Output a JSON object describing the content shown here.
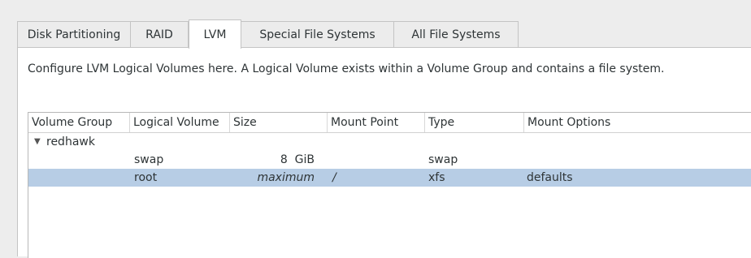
{
  "tabs": [
    {
      "label": "Disk Partitioning",
      "active": false
    },
    {
      "label": "RAID",
      "active": false
    },
    {
      "label": "LVM",
      "active": true
    },
    {
      "label": "Special File Systems",
      "active": false
    },
    {
      "label": "All File Systems",
      "active": false
    }
  ],
  "description": "Configure LVM Logical Volumes here.  A Logical Volume exists within a Volume Group and contains a file system.",
  "columns": {
    "volume_group": "Volume Group",
    "logical_volume": "Logical Volume",
    "size": "Size",
    "mount_point": "Mount Point",
    "type": "Type",
    "mount_options": "Mount Options"
  },
  "tree": {
    "group": {
      "name": "redhawk",
      "expanded": true
    },
    "volumes": [
      {
        "name": "swap",
        "size": "8  GiB",
        "mount_point": "",
        "type": "swap",
        "mount_options": "",
        "selected": false
      },
      {
        "name": "root",
        "size": "maximum",
        "mount_point": "/",
        "type": "xfs",
        "mount_options": "defaults",
        "selected": true
      }
    ]
  },
  "colors": {
    "selection": "#b7cde5",
    "panel": "#ffffff",
    "background": "#ededed"
  }
}
